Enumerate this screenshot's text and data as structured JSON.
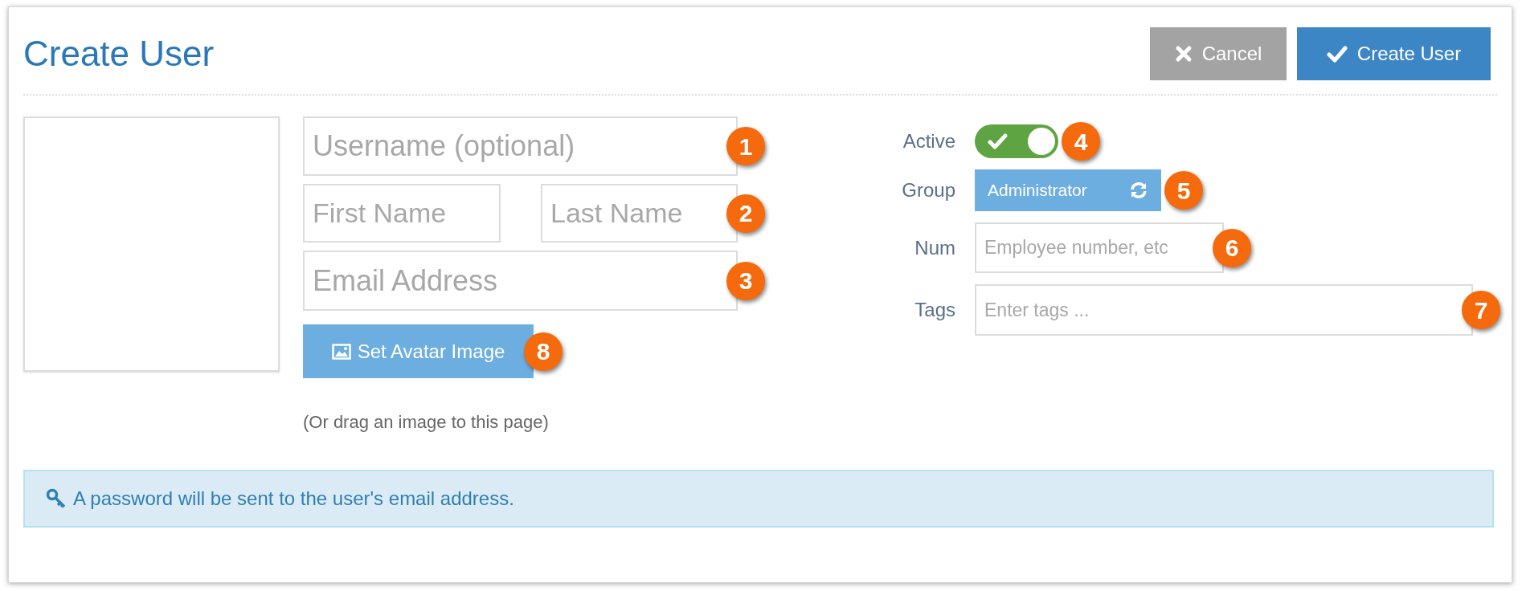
{
  "title": "Create User",
  "buttons": [
    {
      "kind": "cancel",
      "label": "Cancel"
    },
    {
      "kind": "submit",
      "label": "Create User"
    }
  ],
  "username": {
    "placeholder": "Username (optional)",
    "callout": "1"
  },
  "first_name": {
    "placeholder": "First Name"
  },
  "last_name": {
    "placeholder": "Last Name",
    "callout": "2"
  },
  "email": {
    "placeholder": "Email Address",
    "callout": "3"
  },
  "avatar_button": {
    "label": "Set Avatar Image",
    "callout": "8"
  },
  "drag_hint": "(Or drag an image to this page)",
  "active": {
    "label": "Active",
    "on": true,
    "callout": "4"
  },
  "group": {
    "label": "Group",
    "value": "Administrator",
    "callout": "5"
  },
  "num": {
    "label": "Num",
    "placeholder": "Employee number, etc",
    "callout": "6"
  },
  "tags": {
    "label": "Tags",
    "placeholder": "Enter tags ...",
    "callout": "7"
  },
  "notice": "A password will be sent to the user's email address."
}
